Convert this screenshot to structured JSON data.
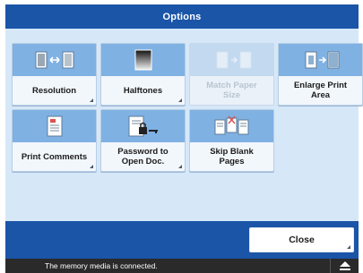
{
  "title": "Options",
  "colors": {
    "header": "#1a55a8",
    "tile_top": "#7fb1e3",
    "panel": "#d6e8f8"
  },
  "tiles": [
    {
      "label": "Resolution",
      "icon": "resolution-icon",
      "enabled": true
    },
    {
      "label": "Halftones",
      "icon": "halftones-icon",
      "enabled": true
    },
    {
      "label": "Match Paper\nSize",
      "icon": "match-paper-size-icon",
      "enabled": false
    },
    {
      "label": "Enlarge Print\nArea",
      "icon": "enlarge-print-area-icon",
      "enabled": true
    },
    {
      "label": "Print Comments",
      "icon": "print-comments-icon",
      "enabled": true
    },
    {
      "label": "Password to\nOpen Doc.",
      "icon": "password-open-doc-icon",
      "enabled": true
    },
    {
      "label": "Skip Blank\nPages",
      "icon": "skip-blank-pages-icon",
      "enabled": true
    }
  ],
  "close_label": "Close",
  "status": {
    "text": "The memory media is connected.",
    "icon": "eject-icon"
  }
}
